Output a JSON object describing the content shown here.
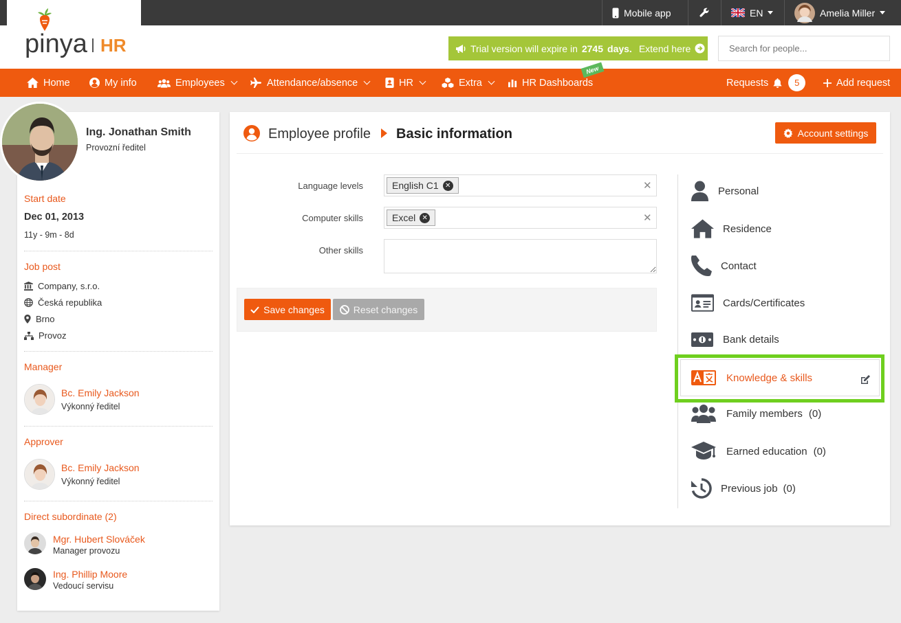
{
  "topbar": {
    "mobile_app": "Mobile app",
    "language": "EN",
    "user_name": "Amelia Miller"
  },
  "brand": {
    "logo_text": "pinya",
    "logo_suffix": "HR",
    "colors": {
      "primary": "#ef5a0f",
      "trial": "#a4c639",
      "highlight": "#6fcf1f"
    }
  },
  "trial": {
    "prefix": "Trial version will expire in",
    "days": "2745",
    "days_suffix": "days.",
    "link": "Extend here"
  },
  "search": {
    "placeholder": "Search for people..."
  },
  "nav": {
    "home": "Home",
    "my_info": "My info",
    "employees": "Employees",
    "attendance": "Attendance/absence",
    "hr": "HR",
    "extra": "Extra",
    "dashboards": "HR Dashboards",
    "new_badge": "New",
    "requests": "Requests",
    "requests_count": "5",
    "add_request": "Add request"
  },
  "profile": {
    "name": "Ing. Jonathan Smith",
    "position": "Provozní ředitel",
    "start_date_label": "Start date",
    "start_date": "Dec 01, 2013",
    "tenure": "11y - 9m - 8d",
    "job_post_label": "Job post",
    "company": "Company, s.r.o.",
    "country": "Česká republika",
    "city": "Brno",
    "department": "Provoz",
    "manager_label": "Manager",
    "manager_name": "Bc. Emily Jackson",
    "manager_role": "Výkonný ředitel",
    "approver_label": "Approver",
    "approver_name": "Bc. Emily Jackson",
    "approver_role": "Výkonný ředitel",
    "subordinates_label": "Direct subordinate (2)",
    "subordinates": [
      {
        "name": "Mgr. Hubert Slováček",
        "role": "Manager provozu"
      },
      {
        "name": "Ing. Phillip Moore",
        "role": "Vedoucí servisu"
      }
    ]
  },
  "main": {
    "breadcrumb_1": "Employee profile",
    "breadcrumb_2": "Basic information",
    "account_settings": "Account settings",
    "language_label": "Language levels",
    "language_tag": "English C1",
    "computer_label": "Computer skills",
    "computer_tag": "Excel",
    "other_label": "Other skills",
    "other_value": "",
    "save": "Save changes",
    "reset": "Reset changes"
  },
  "side_menu": {
    "personal": "Personal",
    "residence": "Residence",
    "contact": "Contact",
    "cards": "Cards/Certificates",
    "bank": "Bank details",
    "knowledge": "Knowledge & skills",
    "family": "Family members",
    "family_count": "(0)",
    "education": "Earned education",
    "education_count": "(0)",
    "previous": "Previous job",
    "previous_count": "(0)"
  }
}
